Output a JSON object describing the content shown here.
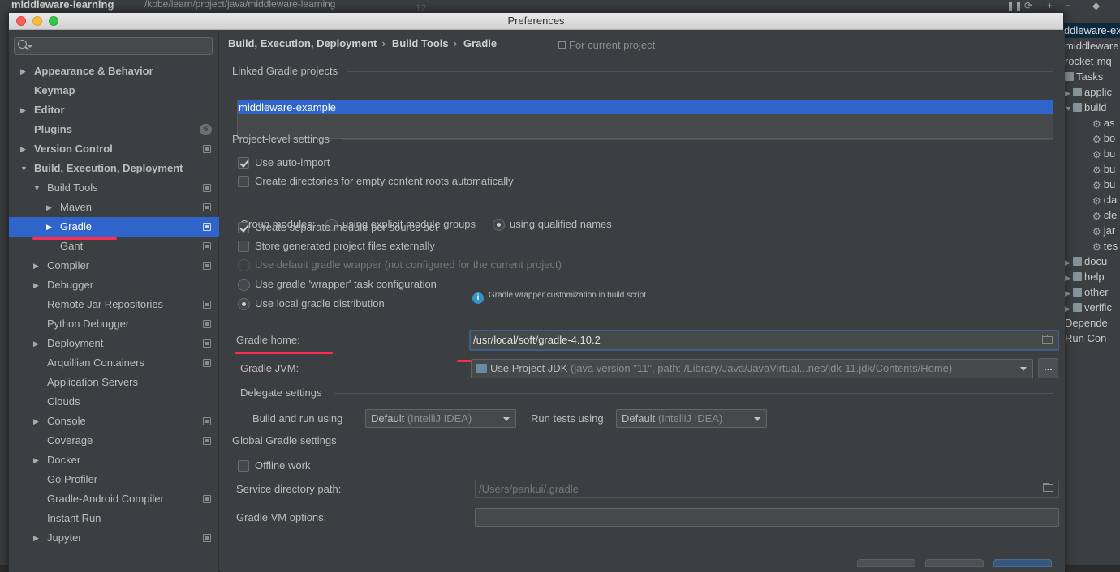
{
  "ide": {
    "project_name": "middleware-learning",
    "project_path": "/kobe/learn/project/java/middleware-learning",
    "line_number": "12",
    "right_panel": [
      {
        "label": "iddleware-ex",
        "type": "header",
        "selected": true
      },
      {
        "label": "middleware",
        "type": "plain"
      },
      {
        "label": "rocket-mq-",
        "type": "plain"
      },
      {
        "label": "Tasks",
        "type": "folder"
      },
      {
        "label": "applic",
        "type": "folder"
      },
      {
        "label": "build",
        "type": "folder"
      },
      {
        "label": "as",
        "type": "gear"
      },
      {
        "label": "bo",
        "type": "gear"
      },
      {
        "label": "bu",
        "type": "gear"
      },
      {
        "label": "bu",
        "type": "gear"
      },
      {
        "label": "bu",
        "type": "gear"
      },
      {
        "label": "cla",
        "type": "gear"
      },
      {
        "label": "cle",
        "type": "gear"
      },
      {
        "label": "jar",
        "type": "gear"
      },
      {
        "label": "tes",
        "type": "gear"
      },
      {
        "label": "docu",
        "type": "folder"
      },
      {
        "label": "help",
        "type": "folder"
      },
      {
        "label": "other",
        "type": "folder"
      },
      {
        "label": "verific",
        "type": "folder"
      },
      {
        "label": "Depende",
        "type": "plain"
      },
      {
        "label": "Run Con",
        "type": "plain"
      }
    ]
  },
  "dialog": {
    "title": "Preferences",
    "search_placeholder": ""
  },
  "sidebar": {
    "items": [
      {
        "label": "Appearance & Behavior",
        "level": 0,
        "arrow": "right",
        "bold": true
      },
      {
        "label": "Keymap",
        "level": 0,
        "arrow": "none",
        "bold": true
      },
      {
        "label": "Editor",
        "level": 0,
        "arrow": "right",
        "bold": true
      },
      {
        "label": "Plugins",
        "level": 0,
        "arrow": "none",
        "bold": true,
        "badge": "6"
      },
      {
        "label": "Version Control",
        "level": 0,
        "arrow": "right",
        "bold": true,
        "project_icon": true
      },
      {
        "label": "Build, Execution, Deployment",
        "level": 0,
        "arrow": "down",
        "bold": true
      },
      {
        "label": "Build Tools",
        "level": 1,
        "arrow": "down",
        "project_icon": true
      },
      {
        "label": "Maven",
        "level": 2,
        "arrow": "right",
        "project_icon": true
      },
      {
        "label": "Gradle",
        "level": 2,
        "arrow": "right",
        "project_icon": true,
        "selected": true
      },
      {
        "label": "Gant",
        "level": 2,
        "arrow": "none",
        "project_icon": true
      },
      {
        "label": "Compiler",
        "level": 1,
        "arrow": "right",
        "project_icon": true
      },
      {
        "label": "Debugger",
        "level": 1,
        "arrow": "right"
      },
      {
        "label": "Remote Jar Repositories",
        "level": 1,
        "arrow": "none",
        "project_icon": true
      },
      {
        "label": "Python Debugger",
        "level": 1,
        "arrow": "none",
        "project_icon": true
      },
      {
        "label": "Deployment",
        "level": 1,
        "arrow": "right",
        "project_icon": true
      },
      {
        "label": "Arquillian Containers",
        "level": 1,
        "arrow": "none",
        "project_icon": true
      },
      {
        "label": "Application Servers",
        "level": 1,
        "arrow": "none"
      },
      {
        "label": "Clouds",
        "level": 1,
        "arrow": "none"
      },
      {
        "label": "Console",
        "level": 1,
        "arrow": "right",
        "project_icon": true
      },
      {
        "label": "Coverage",
        "level": 1,
        "arrow": "none",
        "project_icon": true
      },
      {
        "label": "Docker",
        "level": 1,
        "arrow": "right"
      },
      {
        "label": "Go Profiler",
        "level": 1,
        "arrow": "none"
      },
      {
        "label": "Gradle-Android Compiler",
        "level": 1,
        "arrow": "none",
        "project_icon": true
      },
      {
        "label": "Instant Run",
        "level": 1,
        "arrow": "none"
      },
      {
        "label": "Jupyter",
        "level": 1,
        "arrow": "right",
        "project_icon": true
      }
    ]
  },
  "main": {
    "breadcrumb": [
      "Build, Execution, Deployment",
      "Build Tools",
      "Gradle"
    ],
    "breadcrumb_sep": "›",
    "for_current_project": "For current project",
    "linked_title": "Linked Gradle projects",
    "linked_projects": [
      "middleware-example"
    ],
    "project_level_title": "Project-level settings",
    "use_auto_import": {
      "label": "Use auto-import",
      "checked": true
    },
    "create_dirs": {
      "label": "Create directories for empty content roots automatically",
      "checked": false
    },
    "group_modules": {
      "label": "Group modules:",
      "options": [
        {
          "label": "using explicit module groups",
          "selected": false
        },
        {
          "label": "using qualified names",
          "selected": true
        }
      ]
    },
    "separate_module": {
      "label": "Create separate module per source set",
      "checked": true
    },
    "store_externally": {
      "label": "Store generated project files externally",
      "checked": false
    },
    "radio_default_wrapper": {
      "label": "Use default gradle wrapper (not configured for the current project)",
      "selected": false,
      "disabled": true
    },
    "radio_wrapper_task": {
      "label": "Use gradle 'wrapper' task configuration",
      "selected": false
    },
    "wrapper_note": "Gradle wrapper customization in build script",
    "radio_local": {
      "label": "Use local gradle distribution",
      "selected": true
    },
    "gradle_home_label": "Gradle home:",
    "gradle_home_value": "/usr/local/soft/gradle-4.10.2",
    "gradle_jvm_label": "Gradle JVM:",
    "gradle_jvm_value": "Use Project JDK",
    "gradle_jvm_detail": "(java version \"11\", path: /Library/Java/JavaVirtual...nes/jdk-11.jdk/Contents/Home)",
    "gradle_jvm_more": "...",
    "delegate_title": "Delegate settings",
    "build_run_label": "Build and run using",
    "build_run_value": "Default",
    "build_run_muted": "(IntelliJ IDEA)",
    "run_tests_label": "Run tests using",
    "run_tests_value": "Default",
    "run_tests_muted": "(IntelliJ IDEA)",
    "global_title": "Global Gradle settings",
    "offline_work": {
      "label": "Offline work",
      "checked": false
    },
    "service_dir_label": "Service directory path:",
    "service_dir_value": "/Users/pankui/.gradle",
    "vm_options_label": "Gradle VM options:",
    "vm_options_value": ""
  },
  "colors": {
    "selection": "#2f65ca",
    "annotation": "#ff2a52",
    "panel_bg": "#3c3f41"
  }
}
